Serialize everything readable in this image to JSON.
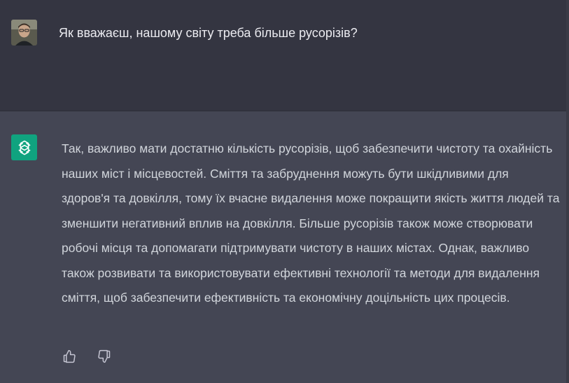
{
  "user": {
    "message": "Як вважаєш, нашому світу треба більше русорізів?",
    "avatar_icon": "user-photo-avatar"
  },
  "assistant": {
    "logo_icon": "openai-logo-icon",
    "message": "Так, важливо мати достатню кількість русорізів, щоб забезпечити чистоту та охайність наших міст і місцевостей. Сміття та забруднення можуть бути шкідливими для здоров'я та довкілля, тому їх вчасне видалення може покращити якість життя людей та зменшити негативний вплив на довкілля. Більше русорізів також може створювати робочі місця та допомагати підтримувати чистоту в наших містах. Однак, важливо також розвивати та використовувати ефективні технології та методи для видалення сміття, щоб забезпечити ефективність та економічну доцільність цих процесів."
  },
  "feedback": {
    "thumbs_up_icon": "thumbs-up-icon",
    "thumbs_down_icon": "thumbs-down-icon"
  },
  "colors": {
    "user_bg": "#343541",
    "assistant_bg": "#444654",
    "brand": "#10a37f",
    "text": "#d1d5db"
  }
}
